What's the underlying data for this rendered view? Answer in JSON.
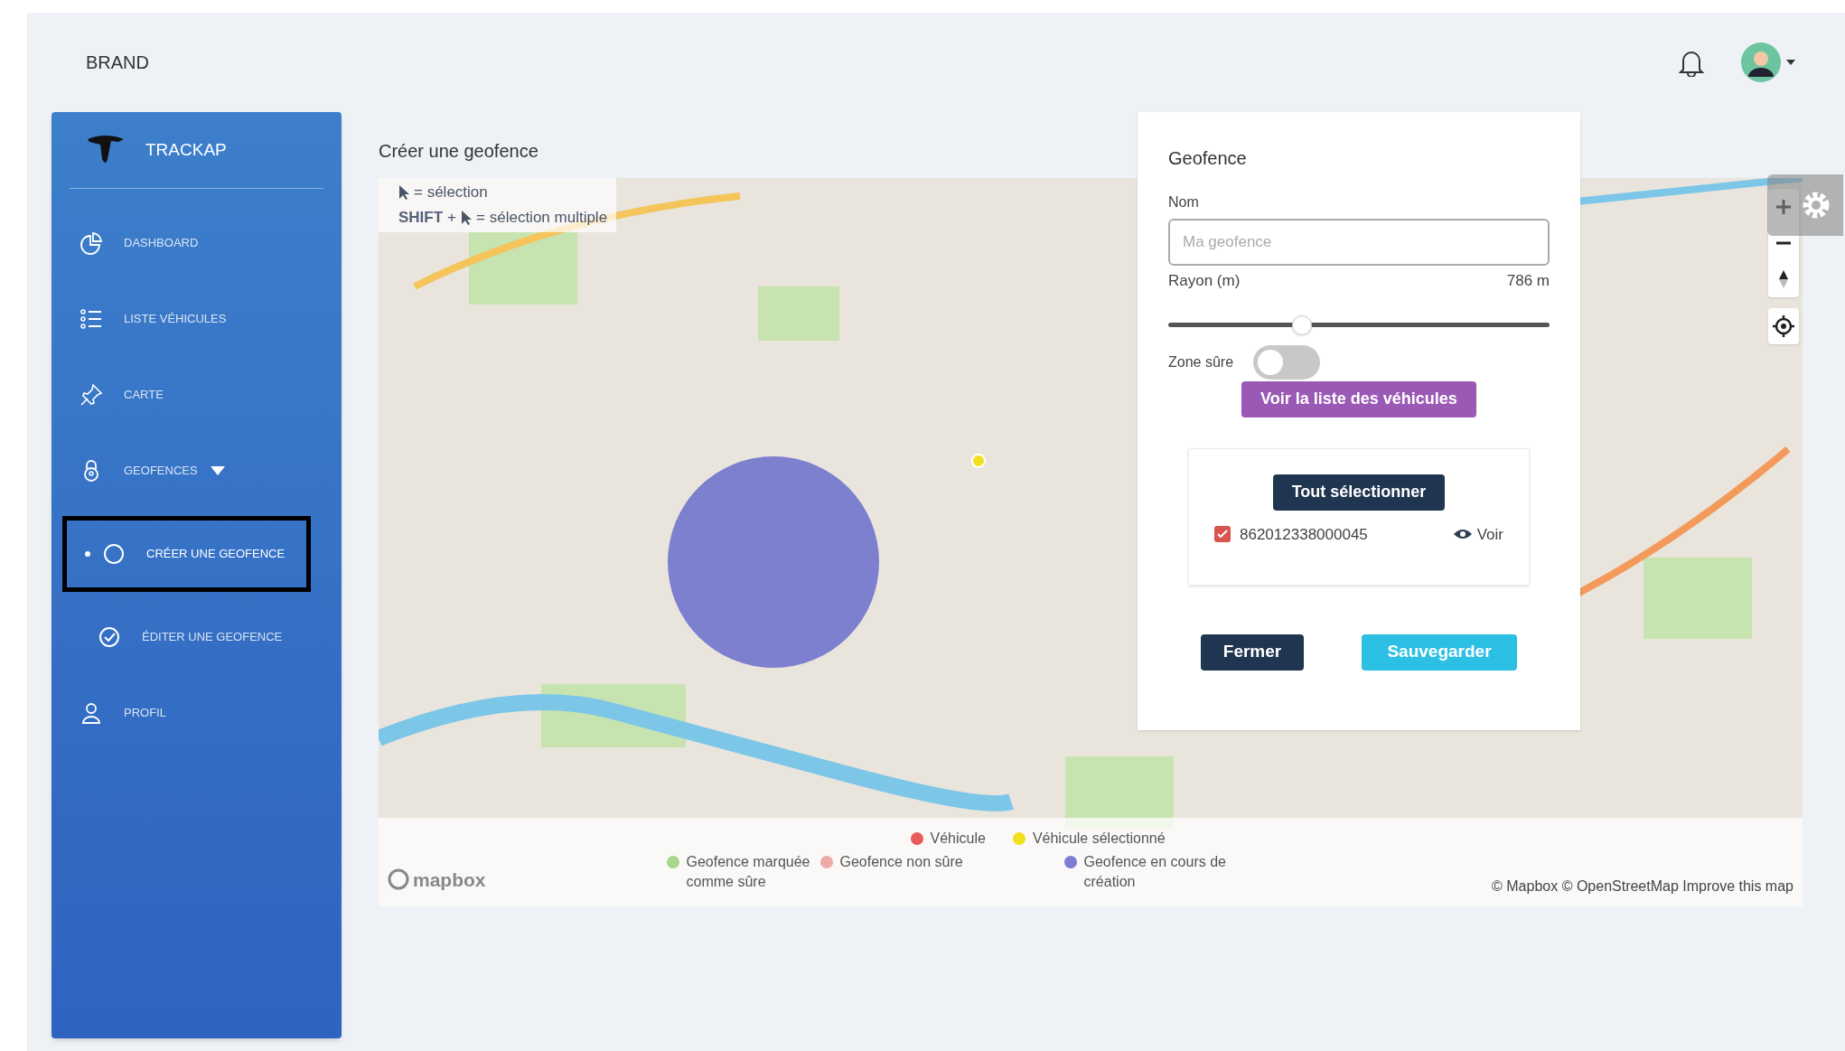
{
  "header": {
    "brand": "BRAND"
  },
  "sidebar": {
    "logo_text": "TRACKAP",
    "items": [
      {
        "kind": "dashboard",
        "label": "DASHBOARD",
        "selected": false
      },
      {
        "kind": "list",
        "label": "LISTE VÉHICULES",
        "selected": false
      },
      {
        "kind": "pin",
        "label": "CARTE",
        "selected": false
      },
      {
        "kind": "lock",
        "label": "GEOFENCES",
        "selected": false,
        "expanded": true,
        "children": [
          {
            "kind": "circle",
            "label": "CRÉER UNE GEOFENCE",
            "selected": true
          },
          {
            "kind": "check",
            "label": "ÉDITER UNE GEOFENCE",
            "selected": false
          }
        ]
      },
      {
        "kind": "user",
        "label": "PROFIL",
        "selected": false
      }
    ]
  },
  "page_title": "Créer une geofence",
  "map": {
    "hints": [
      {
        "text": "= sélection"
      },
      {
        "key": "SHIFT",
        "plus": "+",
        "text": "= sélection multiple"
      }
    ],
    "legend": [
      {
        "label": "Véhicule",
        "color": "#e85b5b"
      },
      {
        "label": "Véhicule sélectionné",
        "color": "#f1e01c"
      },
      {
        "label": "Geofence marquée comme sûre",
        "color": "#a6d68c"
      },
      {
        "label": "Geofence non sûre",
        "color": "#f0a9a9"
      },
      {
        "label": "Geofence en cours de création",
        "color": "#7d7dd3"
      }
    ],
    "attribution": "© Mapbox © OpenStreetMap Improve this map",
    "logo": "mapbox"
  },
  "panel": {
    "title": "Geofence",
    "name_label": "Nom",
    "name_placeholder": "Ma geofence",
    "radius": {
      "label": "Rayon (m)",
      "value": "786 m",
      "level": 0.35
    },
    "safe_label": "Zone sûre",
    "safe_on": false,
    "list_button": "Voir la liste des véhicules",
    "select_all": "Tout sélectionner",
    "vehicles": [
      {
        "id": "862012338000045",
        "checked": true,
        "view": "Voir"
      }
    ],
    "close": "Fermer",
    "save": "Sauvegarder"
  }
}
